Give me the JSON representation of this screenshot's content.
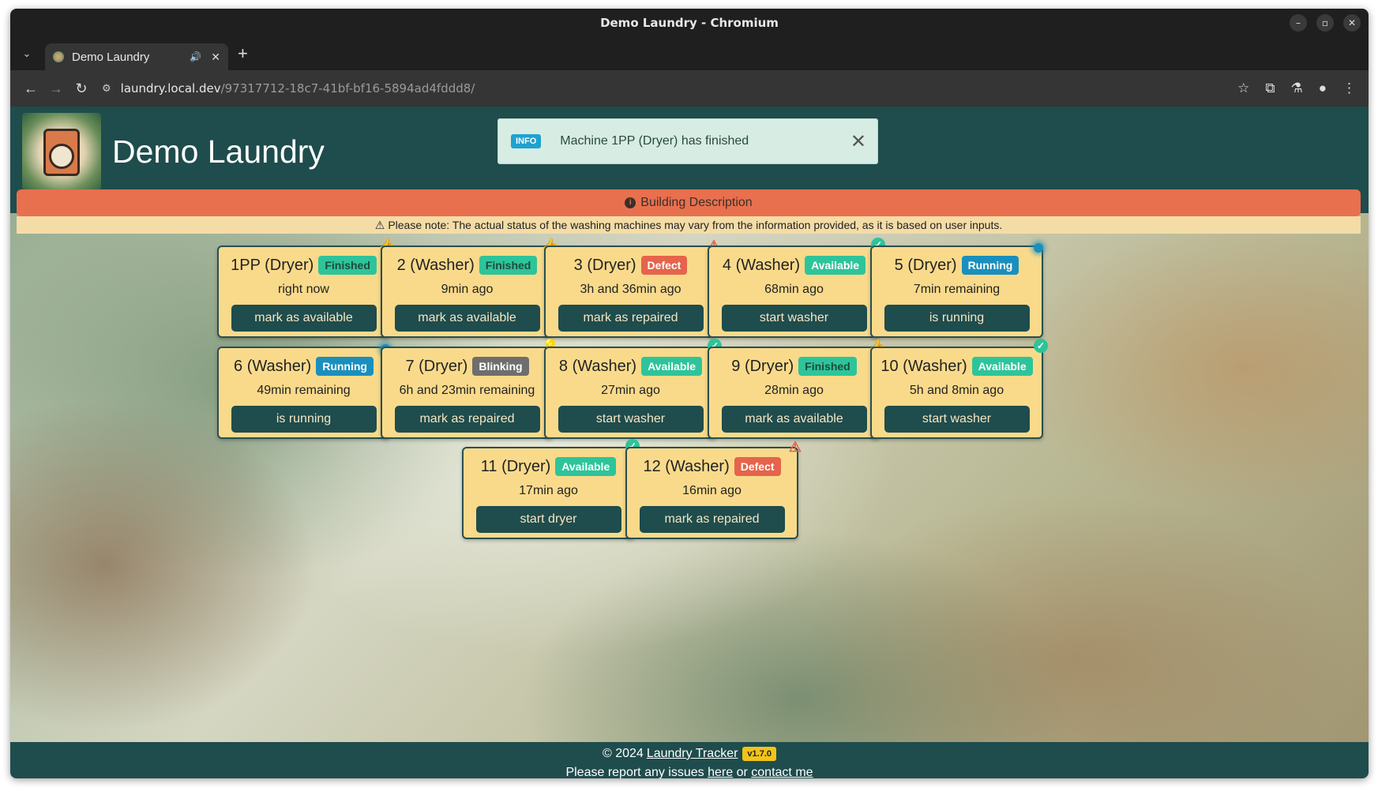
{
  "browser": {
    "window_title": "Demo Laundry - Chromium",
    "tab_title": "Demo Laundry",
    "url_host": "laundry.local.dev",
    "url_path": "/97317712-18c7-41bf-bf16-5894ad4fddd8/"
  },
  "header": {
    "brand": "Demo Laundry"
  },
  "toast": {
    "tag": "INFO",
    "message": "Machine 1PP (Dryer) has finished"
  },
  "building_description": "Building Description",
  "notice": "Please note: The actual status of the washing machines may vary from the information provided, as it is based on user inputs.",
  "machines": [
    {
      "name": "1PP (Dryer)",
      "status": "Finished",
      "time": "right now",
      "action": "mark as available",
      "corner": "thumb"
    },
    {
      "name": "2 (Washer)",
      "status": "Finished",
      "time": "9min ago",
      "action": "mark as available",
      "corner": "thumb"
    },
    {
      "name": "3 (Dryer)",
      "status": "Defect",
      "time": "3h and 36min ago",
      "action": "mark as repaired",
      "corner": "warn"
    },
    {
      "name": "4 (Washer)",
      "status": "Available",
      "time": "68min ago",
      "action": "start washer",
      "corner": "check"
    },
    {
      "name": "5 (Dryer)",
      "status": "Running",
      "time": "7min remaining",
      "action": "is running",
      "corner": "dot"
    },
    {
      "name": "6 (Washer)",
      "status": "Running",
      "time": "49min remaining",
      "action": "is running",
      "corner": "dot"
    },
    {
      "name": "7 (Dryer)",
      "status": "Blinking",
      "time": "6h and 23min remaining",
      "action": "mark as repaired",
      "corner": "bulb"
    },
    {
      "name": "8 (Washer)",
      "status": "Available",
      "time": "27min ago",
      "action": "start washer",
      "corner": "check"
    },
    {
      "name": "9 (Dryer)",
      "status": "Finished",
      "time": "28min ago",
      "action": "mark as available",
      "corner": "thumb"
    },
    {
      "name": "10 (Washer)",
      "status": "Available",
      "time": "5h and 8min ago",
      "action": "start washer",
      "corner": "check"
    },
    {
      "name": "11 (Dryer)",
      "status": "Available",
      "time": "17min ago",
      "action": "start dryer",
      "corner": "check"
    },
    {
      "name": "12 (Washer)",
      "status": "Defect",
      "time": "16min ago",
      "action": "mark as repaired",
      "corner": "warn"
    }
  ],
  "footer": {
    "copyright": "© 2024",
    "app_link": "Laundry Tracker",
    "version": "v1.7.0",
    "report_prefix": "Please report any issues",
    "here_link": "here",
    "or_text": "or",
    "contact_link": "contact me"
  },
  "colors": {
    "header_bg": "#1f4c4c",
    "card_bg": "#f9da8b",
    "desc_bar": "#e8704e",
    "available": "#2ec49a",
    "defect": "#e5644b",
    "running": "#1a8fbd",
    "blinking": "#6e6e6e"
  }
}
